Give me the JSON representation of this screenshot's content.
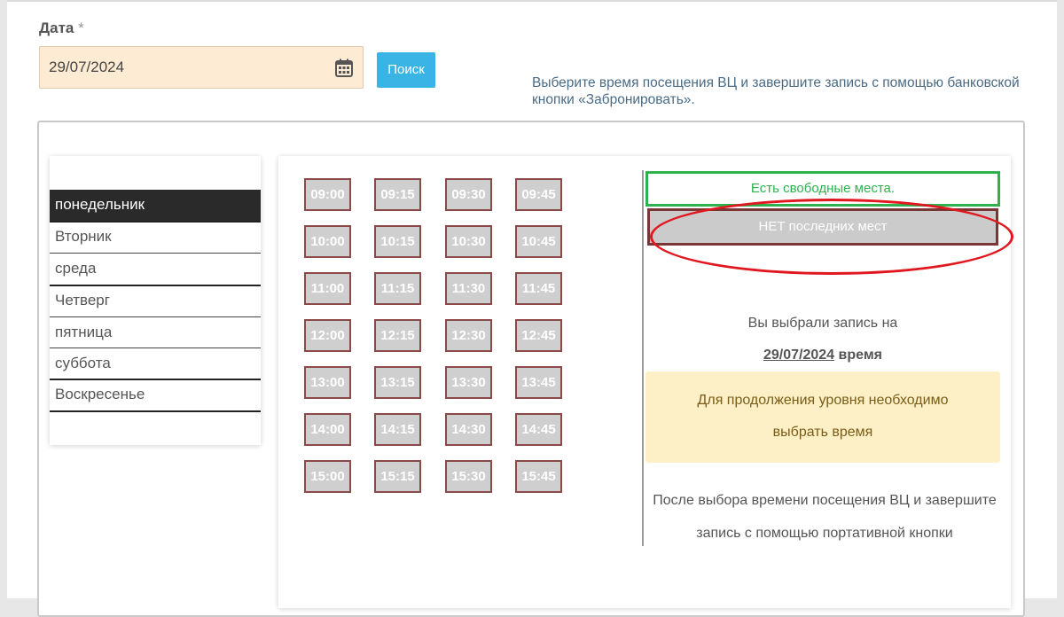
{
  "form": {
    "date_label": "Дата",
    "required_mark": "*",
    "date_value": "29/07/2024",
    "search_button": "Поиск",
    "hint": "Выберите время посещения ВЦ и завершите запись с помощью банковской кнопки «Забронировать»."
  },
  "days": [
    {
      "label": "понедельник",
      "active": true
    },
    {
      "label": "Вторник",
      "active": false
    },
    {
      "label": "среда",
      "active": false
    },
    {
      "label": "Четверг",
      "active": false
    },
    {
      "label": "пятница",
      "active": false
    },
    {
      "label": "суббота",
      "active": false
    },
    {
      "label": "Воскресенье",
      "active": false
    }
  ],
  "time_slots": [
    [
      "09:00",
      "09:15",
      "09:30",
      "09:45"
    ],
    [
      "10:00",
      "10:15",
      "10:30",
      "10:45"
    ],
    [
      "11:00",
      "11:15",
      "11:30",
      "11:45"
    ],
    [
      "12:00",
      "12:15",
      "12:30",
      "12:45"
    ],
    [
      "13:00",
      "13:15",
      "13:30",
      "13:45"
    ],
    [
      "14:00",
      "14:15",
      "14:30",
      "14:45"
    ],
    [
      "15:00",
      "15:15",
      "15:30",
      "15:45"
    ]
  ],
  "legend": {
    "free": "Есть свободные места.",
    "none": "НЕТ последних мест"
  },
  "selection": {
    "chosen_text": "Вы выбрали запись на",
    "chosen_date": "29/07/2024",
    "time_word": "время",
    "warning_line1": "Для продолжения уровня необходимо",
    "warning_line2": "выбрать время",
    "after_line1": "После выбора времени посещения ВЦ и завершите",
    "after_line2": "запись с помощью портативной кнопки"
  },
  "colors": {
    "accent": "#3ab4e4",
    "free_green": "#2eb24e",
    "slot_border": "#8b4a48",
    "annotation_red": "#e0171f"
  }
}
